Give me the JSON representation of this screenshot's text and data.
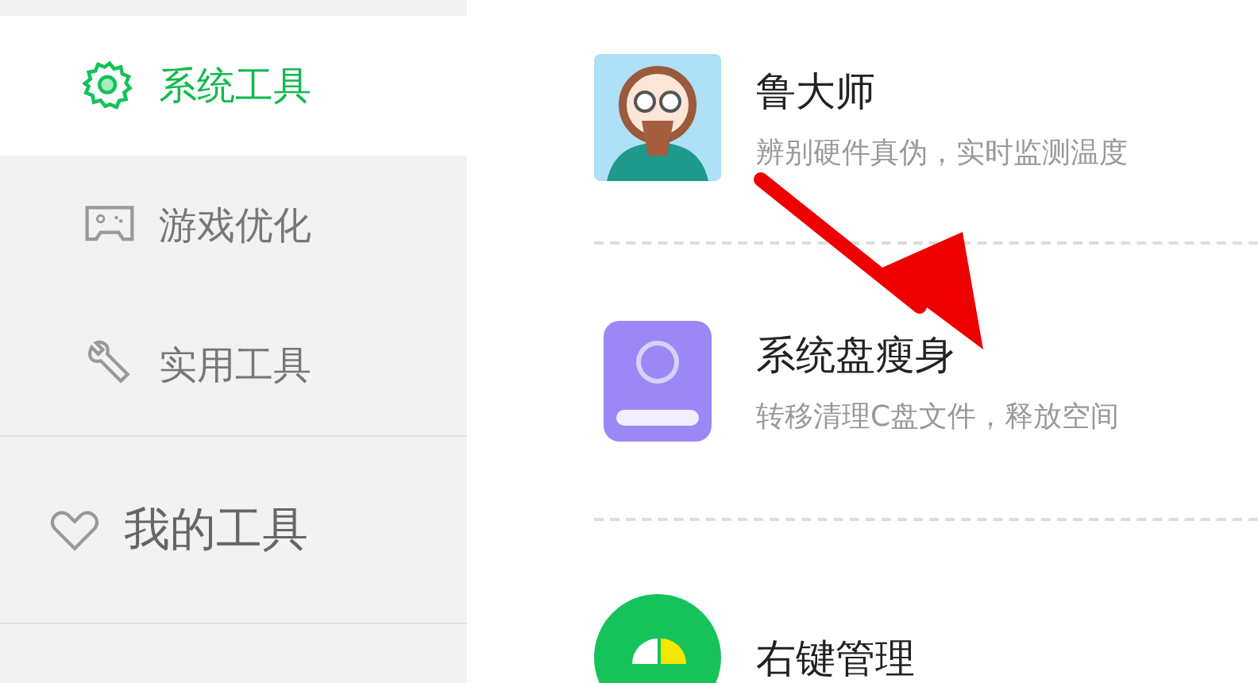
{
  "sidebar": {
    "items": [
      {
        "label": "系统工具",
        "selected": true,
        "kind": "nav"
      },
      {
        "label": "游戏优化",
        "selected": false,
        "kind": "nav"
      },
      {
        "label": "实用工具",
        "selected": false,
        "kind": "nav"
      },
      {
        "label": "我的工具",
        "selected": false,
        "kind": "group"
      }
    ]
  },
  "tools": [
    {
      "title": "鲁大师",
      "description": "辨别硬件真伪，实时监测温度"
    },
    {
      "title": "系统盘瘦身",
      "description": "转移清理C盘文件，释放空间"
    },
    {
      "title": "右键管理"
    }
  ],
  "annotation": {
    "kind": "arrow"
  }
}
